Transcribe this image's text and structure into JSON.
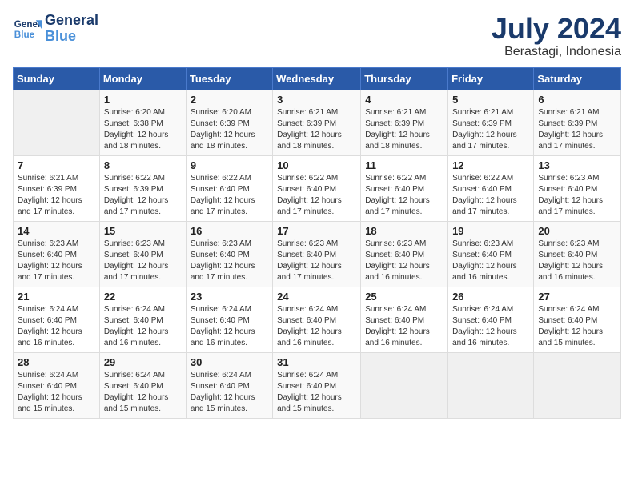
{
  "logo": {
    "line1": "General",
    "line2": "Blue"
  },
  "title": "July 2024",
  "location": "Berastagi, Indonesia",
  "days_header": [
    "Sunday",
    "Monday",
    "Tuesday",
    "Wednesday",
    "Thursday",
    "Friday",
    "Saturday"
  ],
  "weeks": [
    [
      {
        "day": "",
        "info": ""
      },
      {
        "day": "1",
        "info": "Sunrise: 6:20 AM\nSunset: 6:38 PM\nDaylight: 12 hours\nand 18 minutes."
      },
      {
        "day": "2",
        "info": "Sunrise: 6:20 AM\nSunset: 6:39 PM\nDaylight: 12 hours\nand 18 minutes."
      },
      {
        "day": "3",
        "info": "Sunrise: 6:21 AM\nSunset: 6:39 PM\nDaylight: 12 hours\nand 18 minutes."
      },
      {
        "day": "4",
        "info": "Sunrise: 6:21 AM\nSunset: 6:39 PM\nDaylight: 12 hours\nand 18 minutes."
      },
      {
        "day": "5",
        "info": "Sunrise: 6:21 AM\nSunset: 6:39 PM\nDaylight: 12 hours\nand 17 minutes."
      },
      {
        "day": "6",
        "info": "Sunrise: 6:21 AM\nSunset: 6:39 PM\nDaylight: 12 hours\nand 17 minutes."
      }
    ],
    [
      {
        "day": "7",
        "info": "Sunrise: 6:21 AM\nSunset: 6:39 PM\nDaylight: 12 hours\nand 17 minutes."
      },
      {
        "day": "8",
        "info": "Sunrise: 6:22 AM\nSunset: 6:39 PM\nDaylight: 12 hours\nand 17 minutes."
      },
      {
        "day": "9",
        "info": "Sunrise: 6:22 AM\nSunset: 6:40 PM\nDaylight: 12 hours\nand 17 minutes."
      },
      {
        "day": "10",
        "info": "Sunrise: 6:22 AM\nSunset: 6:40 PM\nDaylight: 12 hours\nand 17 minutes."
      },
      {
        "day": "11",
        "info": "Sunrise: 6:22 AM\nSunset: 6:40 PM\nDaylight: 12 hours\nand 17 minutes."
      },
      {
        "day": "12",
        "info": "Sunrise: 6:22 AM\nSunset: 6:40 PM\nDaylight: 12 hours\nand 17 minutes."
      },
      {
        "day": "13",
        "info": "Sunrise: 6:23 AM\nSunset: 6:40 PM\nDaylight: 12 hours\nand 17 minutes."
      }
    ],
    [
      {
        "day": "14",
        "info": "Sunrise: 6:23 AM\nSunset: 6:40 PM\nDaylight: 12 hours\nand 17 minutes."
      },
      {
        "day": "15",
        "info": "Sunrise: 6:23 AM\nSunset: 6:40 PM\nDaylight: 12 hours\nand 17 minutes."
      },
      {
        "day": "16",
        "info": "Sunrise: 6:23 AM\nSunset: 6:40 PM\nDaylight: 12 hours\nand 17 minutes."
      },
      {
        "day": "17",
        "info": "Sunrise: 6:23 AM\nSunset: 6:40 PM\nDaylight: 12 hours\nand 17 minutes."
      },
      {
        "day": "18",
        "info": "Sunrise: 6:23 AM\nSunset: 6:40 PM\nDaylight: 12 hours\nand 16 minutes."
      },
      {
        "day": "19",
        "info": "Sunrise: 6:23 AM\nSunset: 6:40 PM\nDaylight: 12 hours\nand 16 minutes."
      },
      {
        "day": "20",
        "info": "Sunrise: 6:23 AM\nSunset: 6:40 PM\nDaylight: 12 hours\nand 16 minutes."
      }
    ],
    [
      {
        "day": "21",
        "info": "Sunrise: 6:24 AM\nSunset: 6:40 PM\nDaylight: 12 hours\nand 16 minutes."
      },
      {
        "day": "22",
        "info": "Sunrise: 6:24 AM\nSunset: 6:40 PM\nDaylight: 12 hours\nand 16 minutes."
      },
      {
        "day": "23",
        "info": "Sunrise: 6:24 AM\nSunset: 6:40 PM\nDaylight: 12 hours\nand 16 minutes."
      },
      {
        "day": "24",
        "info": "Sunrise: 6:24 AM\nSunset: 6:40 PM\nDaylight: 12 hours\nand 16 minutes."
      },
      {
        "day": "25",
        "info": "Sunrise: 6:24 AM\nSunset: 6:40 PM\nDaylight: 12 hours\nand 16 minutes."
      },
      {
        "day": "26",
        "info": "Sunrise: 6:24 AM\nSunset: 6:40 PM\nDaylight: 12 hours\nand 16 minutes."
      },
      {
        "day": "27",
        "info": "Sunrise: 6:24 AM\nSunset: 6:40 PM\nDaylight: 12 hours\nand 15 minutes."
      }
    ],
    [
      {
        "day": "28",
        "info": "Sunrise: 6:24 AM\nSunset: 6:40 PM\nDaylight: 12 hours\nand 15 minutes."
      },
      {
        "day": "29",
        "info": "Sunrise: 6:24 AM\nSunset: 6:40 PM\nDaylight: 12 hours\nand 15 minutes."
      },
      {
        "day": "30",
        "info": "Sunrise: 6:24 AM\nSunset: 6:40 PM\nDaylight: 12 hours\nand 15 minutes."
      },
      {
        "day": "31",
        "info": "Sunrise: 6:24 AM\nSunset: 6:40 PM\nDaylight: 12 hours\nand 15 minutes."
      },
      {
        "day": "",
        "info": ""
      },
      {
        "day": "",
        "info": ""
      },
      {
        "day": "",
        "info": ""
      }
    ]
  ]
}
